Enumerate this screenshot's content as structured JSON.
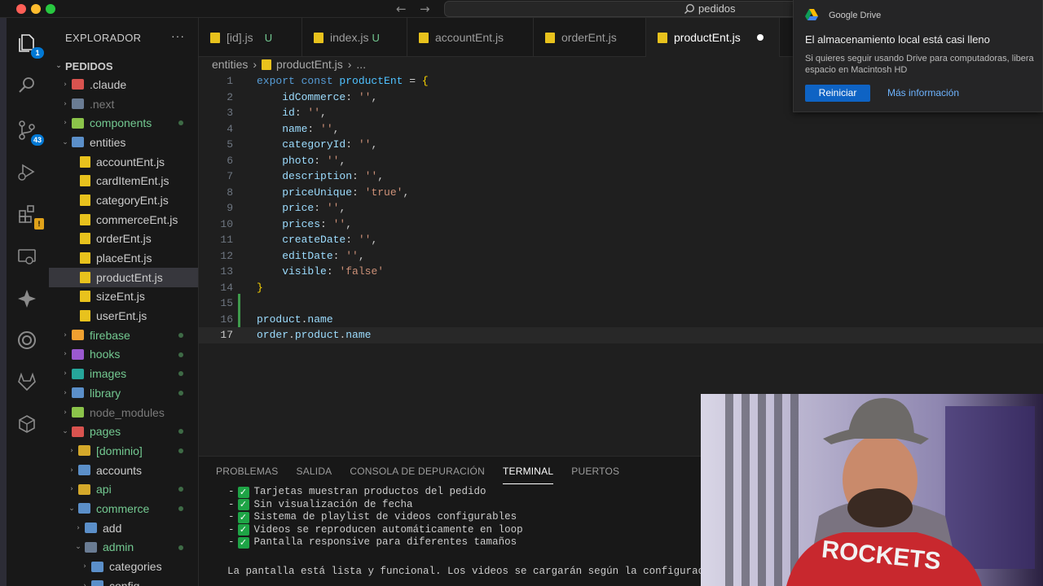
{
  "window": {
    "title": "pedidos",
    "back_arrow": "←",
    "forward_arrow": "→"
  },
  "activity_bar": {
    "explorer_badge": "1",
    "scm_badge": "43",
    "extensions_warning": "!"
  },
  "sidebar": {
    "header": "EXPLORADOR",
    "more": "···",
    "root": "PEDIDOS",
    "items": [
      {
        "label": ".claude",
        "indent": 1,
        "chevron": "›",
        "icon": "folder-red",
        "color": "default"
      },
      {
        "label": ".next",
        "indent": 1,
        "chevron": "›",
        "icon": "folder-gear",
        "color": "gray"
      },
      {
        "label": "components",
        "indent": 1,
        "chevron": "›",
        "icon": "folder-green",
        "color": "green",
        "dot": true
      },
      {
        "label": "entities",
        "indent": 1,
        "chevron": "⌄",
        "icon": "folder-open-blue",
        "color": "default"
      },
      {
        "label": "accountEnt.js",
        "indent": 2,
        "chevron": "",
        "icon": "js",
        "color": "default"
      },
      {
        "label": "cardItemEnt.js",
        "indent": 2,
        "chevron": "",
        "icon": "js",
        "color": "default"
      },
      {
        "label": "categoryEnt.js",
        "indent": 2,
        "chevron": "",
        "icon": "js",
        "color": "default"
      },
      {
        "label": "commerceEnt.js",
        "indent": 2,
        "chevron": "",
        "icon": "js",
        "color": "default"
      },
      {
        "label": "orderEnt.js",
        "indent": 2,
        "chevron": "",
        "icon": "js",
        "color": "default"
      },
      {
        "label": "placeEnt.js",
        "indent": 2,
        "chevron": "",
        "icon": "js",
        "color": "default"
      },
      {
        "label": "productEnt.js",
        "indent": 2,
        "chevron": "",
        "icon": "js",
        "color": "default",
        "selected": true
      },
      {
        "label": "sizeEnt.js",
        "indent": 2,
        "chevron": "",
        "icon": "js",
        "color": "default"
      },
      {
        "label": "userEnt.js",
        "indent": 2,
        "chevron": "",
        "icon": "js",
        "color": "default"
      },
      {
        "label": "firebase",
        "indent": 1,
        "chevron": "›",
        "icon": "folder-orange",
        "color": "green",
        "dot": true
      },
      {
        "label": "hooks",
        "indent": 1,
        "chevron": "›",
        "icon": "folder-purple",
        "color": "green",
        "dot": true
      },
      {
        "label": "images",
        "indent": 1,
        "chevron": "›",
        "icon": "folder-teal",
        "color": "green",
        "dot": true
      },
      {
        "label": "library",
        "indent": 1,
        "chevron": "›",
        "icon": "folder-blue",
        "color": "green",
        "dot": true
      },
      {
        "label": "node_modules",
        "indent": 1,
        "chevron": "›",
        "icon": "folder-green",
        "color": "gray"
      },
      {
        "label": "pages",
        "indent": 1,
        "chevron": "⌄",
        "icon": "folder-red",
        "color": "green",
        "dot": true
      },
      {
        "label": "[dominio]",
        "indent": 2,
        "chevron": "›",
        "icon": "folder-yellow",
        "color": "green",
        "dot": true
      },
      {
        "label": "accounts",
        "indent": 2,
        "chevron": "›",
        "icon": "folder-blue",
        "color": "default"
      },
      {
        "label": "api",
        "indent": 2,
        "chevron": "›",
        "icon": "folder-yellow",
        "color": "green",
        "dot": true
      },
      {
        "label": "commerce",
        "indent": 2,
        "chevron": "⌄",
        "icon": "folder-open-blue",
        "color": "green",
        "dot": true
      },
      {
        "label": "add",
        "indent": 3,
        "chevron": "›",
        "icon": "folder-blue",
        "color": "default"
      },
      {
        "label": "admin",
        "indent": 3,
        "chevron": "⌄",
        "icon": "folder-gear",
        "color": "green",
        "dot": true
      },
      {
        "label": "categories",
        "indent": 4,
        "chevron": "›",
        "icon": "folder-blue",
        "color": "default"
      },
      {
        "label": "config",
        "indent": 4,
        "chevron": "›",
        "icon": "folder-blue",
        "color": "default"
      }
    ]
  },
  "tabs": [
    {
      "label": "[id].js",
      "status": "U"
    },
    {
      "label": "index.js",
      "status": "U"
    },
    {
      "label": "accountEnt.js",
      "status": ""
    },
    {
      "label": "orderEnt.js",
      "status": ""
    },
    {
      "label": "productEnt.js",
      "status": "",
      "active": true,
      "modified": true
    }
  ],
  "breadcrumb": {
    "folder": "entities",
    "sep": "›",
    "file": "productEnt.js",
    "more": "..."
  },
  "editor": {
    "current_line": 17,
    "lines": [
      [
        {
          "t": "export const ",
          "c": "kw"
        },
        {
          "t": "productEnt",
          "c": "var"
        },
        {
          "t": " = ",
          "c": "pun"
        },
        {
          "t": "{",
          "c": "brk"
        }
      ],
      [
        {
          "t": "    idCommerce",
          "c": "prop"
        },
        {
          "t": ": ",
          "c": "pun"
        },
        {
          "t": "''",
          "c": "str"
        },
        {
          "t": ",",
          "c": "pun"
        }
      ],
      [
        {
          "t": "    id",
          "c": "prop"
        },
        {
          "t": ": ",
          "c": "pun"
        },
        {
          "t": "''",
          "c": "str"
        },
        {
          "t": ",",
          "c": "pun"
        }
      ],
      [
        {
          "t": "    name",
          "c": "prop"
        },
        {
          "t": ": ",
          "c": "pun"
        },
        {
          "t": "''",
          "c": "str"
        },
        {
          "t": ",",
          "c": "pun"
        }
      ],
      [
        {
          "t": "    categoryId",
          "c": "prop"
        },
        {
          "t": ": ",
          "c": "pun"
        },
        {
          "t": "''",
          "c": "str"
        },
        {
          "t": ",",
          "c": "pun"
        }
      ],
      [
        {
          "t": "    photo",
          "c": "prop"
        },
        {
          "t": ": ",
          "c": "pun"
        },
        {
          "t": "''",
          "c": "str"
        },
        {
          "t": ",",
          "c": "pun"
        }
      ],
      [
        {
          "t": "    description",
          "c": "prop"
        },
        {
          "t": ": ",
          "c": "pun"
        },
        {
          "t": "''",
          "c": "str"
        },
        {
          "t": ",",
          "c": "pun"
        }
      ],
      [
        {
          "t": "    priceUnique",
          "c": "prop"
        },
        {
          "t": ": ",
          "c": "pun"
        },
        {
          "t": "'true'",
          "c": "str"
        },
        {
          "t": ",",
          "c": "pun"
        }
      ],
      [
        {
          "t": "    price",
          "c": "prop"
        },
        {
          "t": ": ",
          "c": "pun"
        },
        {
          "t": "''",
          "c": "str"
        },
        {
          "t": ",",
          "c": "pun"
        }
      ],
      [
        {
          "t": "    prices",
          "c": "prop"
        },
        {
          "t": ": ",
          "c": "pun"
        },
        {
          "t": "''",
          "c": "str"
        },
        {
          "t": ",",
          "c": "pun"
        }
      ],
      [
        {
          "t": "    createDate",
          "c": "prop"
        },
        {
          "t": ": ",
          "c": "pun"
        },
        {
          "t": "''",
          "c": "str"
        },
        {
          "t": ",",
          "c": "pun"
        }
      ],
      [
        {
          "t": "    editDate",
          "c": "prop"
        },
        {
          "t": ": ",
          "c": "pun"
        },
        {
          "t": "''",
          "c": "str"
        },
        {
          "t": ",",
          "c": "pun"
        }
      ],
      [
        {
          "t": "    visible",
          "c": "prop"
        },
        {
          "t": ": ",
          "c": "pun"
        },
        {
          "t": "'false'",
          "c": "str"
        }
      ],
      [
        {
          "t": "}",
          "c": "brk"
        }
      ],
      [],
      [
        {
          "t": "product",
          "c": "plain"
        },
        {
          "t": ".",
          "c": "pun"
        },
        {
          "t": "name",
          "c": "plain"
        }
      ],
      [
        {
          "t": "order",
          "c": "plain"
        },
        {
          "t": ".",
          "c": "pun"
        },
        {
          "t": "product",
          "c": "plain"
        },
        {
          "t": ".",
          "c": "pun"
        },
        {
          "t": "name",
          "c": "plain"
        }
      ]
    ]
  },
  "panel": {
    "tabs": [
      "PROBLEMAS",
      "SALIDA",
      "CONSOLA DE DEPURACIÓN",
      "TERMINAL",
      "PUERTOS"
    ],
    "active_tab": "TERMINAL",
    "terminal_checklist": [
      "Tarjetas muestran productos del pedido",
      "Sin visualización de fecha",
      "Sistema de playlist de videos configurables",
      "Videos se reproducen automáticamente en loop",
      "Pantalla responsive para diferentes tamaños"
    ],
    "bullet": "-",
    "check": "✓",
    "terminal_note": "La pantalla está lista y funcional. Los videos se cargarán según la configuración"
  },
  "notification": {
    "app": "Google Drive",
    "title": "El almacenamiento local está casi lleno",
    "message": "Si quieres seguir usando Drive para computadoras, libera espacio en Macintosh HD",
    "primary_button": "Reiniciar",
    "secondary_link": "Más información"
  },
  "colors": {
    "accent": "#0078d4",
    "git_added": "#73c991",
    "js_icon": "#e8c21d",
    "editor_bg": "#1f1f1f",
    "sidebar_bg": "#181818"
  }
}
